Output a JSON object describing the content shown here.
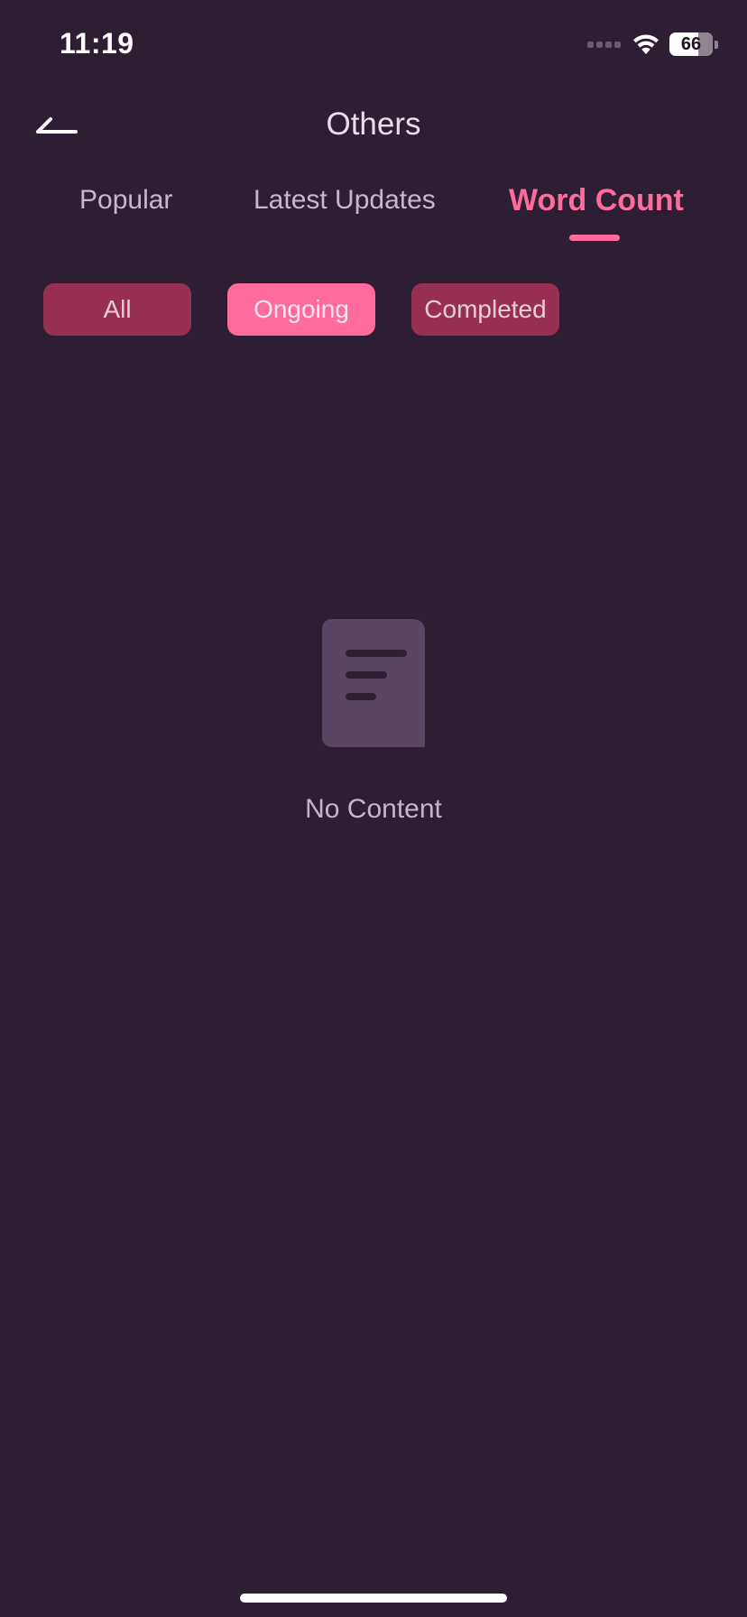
{
  "status_bar": {
    "time": "11:19",
    "battery_level": "66"
  },
  "header": {
    "title": "Others",
    "back_icon": "back-arrow-icon"
  },
  "tabs": [
    {
      "label": "Popular",
      "active": false
    },
    {
      "label": "Latest Updates",
      "active": false
    },
    {
      "label": "Word Count",
      "active": true
    }
  ],
  "filters": [
    {
      "label": "All",
      "selected": false
    },
    {
      "label": "Ongoing",
      "selected": true
    },
    {
      "label": "Completed",
      "selected": false
    }
  ],
  "empty_state": {
    "icon": "document-icon",
    "message": "No Content"
  },
  "colors": {
    "background": "#2d1e33",
    "accent": "#ff6b9a",
    "chip_inactive": "#962f52",
    "muted_text": "#c9b6cc",
    "icon_fill": "#5a4563"
  }
}
